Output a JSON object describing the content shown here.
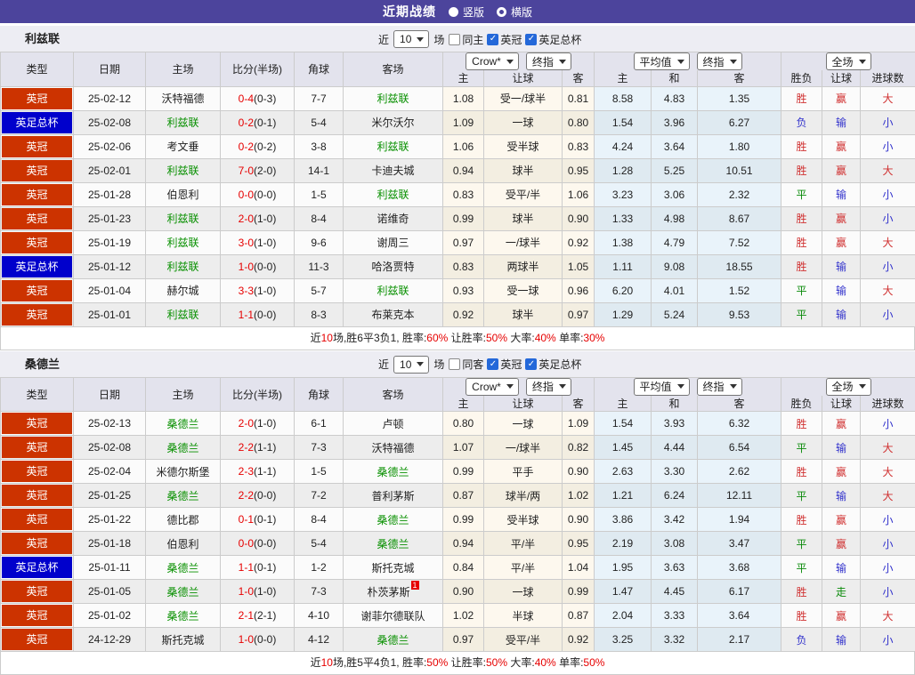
{
  "title_bar": {
    "title": "近期战绩",
    "radios": [
      {
        "label": "竖版",
        "selected": true
      },
      {
        "label": "横版",
        "selected": false
      }
    ]
  },
  "colors": {
    "accent_purple": "#4c449c",
    "league_championship_red": "#cc3300",
    "league_facup_blue": "#0000cc",
    "focus_team_green": "#089000",
    "score_red": "#e60000",
    "result_win_red": "#d03030",
    "result_lose_blue": "#3333cc",
    "result_draw_green": "#0a8a0a"
  },
  "result_color_map": {
    "胜": "red",
    "赢": "red",
    "大": "red",
    "平": "green",
    "走": "green",
    "负": "blue",
    "输": "blue",
    "小": "blue"
  },
  "sections": [
    {
      "team": "利兹联",
      "filter": {
        "prefix": "近",
        "count": "10",
        "suffix": "场",
        "checkboxes": [
          {
            "label": "同主",
            "checked": false
          },
          {
            "label": "英冠",
            "checked": true
          },
          {
            "label": "英足总杯",
            "checked": true
          }
        ]
      },
      "header": {
        "cols": [
          "类型",
          "日期",
          "主场",
          "比分(半场)",
          "角球",
          "客场"
        ],
        "group1_selects": [
          "Crow*",
          "终指"
        ],
        "group2_selects": [
          "平均值",
          "终指"
        ],
        "group3_selects": [
          "全场"
        ],
        "sub": [
          "主",
          "让球",
          "客",
          "主",
          "和",
          "客",
          "胜负",
          "让球",
          "进球数"
        ]
      },
      "rows": [
        {
          "league": "英冠",
          "date": "25-02-12",
          "home": "沃特福德",
          "home_focus": false,
          "score": "0-4",
          "half": "(0-3)",
          "corner": "7-7",
          "away": "利兹联",
          "away_focus": true,
          "odds": [
            "1.08",
            "受一/球半",
            "0.81"
          ],
          "avg": [
            "8.58",
            "4.83",
            "1.35"
          ],
          "results": [
            "胜",
            "赢",
            "大"
          ]
        },
        {
          "league": "英足总杯",
          "date": "25-02-08",
          "home": "利兹联",
          "home_focus": true,
          "score": "0-2",
          "half": "(0-1)",
          "corner": "5-4",
          "away": "米尔沃尔",
          "away_focus": false,
          "odds": [
            "1.09",
            "一球",
            "0.80"
          ],
          "avg": [
            "1.54",
            "3.96",
            "6.27"
          ],
          "results": [
            "负",
            "输",
            "小"
          ]
        },
        {
          "league": "英冠",
          "date": "25-02-06",
          "home": "考文垂",
          "home_focus": false,
          "score": "0-2",
          "half": "(0-2)",
          "corner": "3-8",
          "away": "利兹联",
          "away_focus": true,
          "odds": [
            "1.06",
            "受半球",
            "0.83"
          ],
          "avg": [
            "4.24",
            "3.64",
            "1.80"
          ],
          "results": [
            "胜",
            "赢",
            "小"
          ]
        },
        {
          "league": "英冠",
          "date": "25-02-01",
          "home": "利兹联",
          "home_focus": true,
          "score": "7-0",
          "half": "(2-0)",
          "corner": "14-1",
          "away": "卡迪夫城",
          "away_focus": false,
          "odds": [
            "0.94",
            "球半",
            "0.95"
          ],
          "avg": [
            "1.28",
            "5.25",
            "10.51"
          ],
          "results": [
            "胜",
            "赢",
            "大"
          ]
        },
        {
          "league": "英冠",
          "date": "25-01-28",
          "home": "伯恩利",
          "home_focus": false,
          "score": "0-0",
          "half": "(0-0)",
          "corner": "1-5",
          "away": "利兹联",
          "away_focus": true,
          "odds": [
            "0.83",
            "受平/半",
            "1.06"
          ],
          "avg": [
            "3.23",
            "3.06",
            "2.32"
          ],
          "results": [
            "平",
            "输",
            "小"
          ]
        },
        {
          "league": "英冠",
          "date": "25-01-23",
          "home": "利兹联",
          "home_focus": true,
          "score": "2-0",
          "half": "(1-0)",
          "corner": "8-4",
          "away": "诺维奇",
          "away_focus": false,
          "odds": [
            "0.99",
            "球半",
            "0.90"
          ],
          "avg": [
            "1.33",
            "4.98",
            "8.67"
          ],
          "results": [
            "胜",
            "赢",
            "小"
          ]
        },
        {
          "league": "英冠",
          "date": "25-01-19",
          "home": "利兹联",
          "home_focus": true,
          "score": "3-0",
          "half": "(1-0)",
          "corner": "9-6",
          "away": "谢周三",
          "away_focus": false,
          "odds": [
            "0.97",
            "一/球半",
            "0.92"
          ],
          "avg": [
            "1.38",
            "4.79",
            "7.52"
          ],
          "results": [
            "胜",
            "赢",
            "大"
          ]
        },
        {
          "league": "英足总杯",
          "date": "25-01-12",
          "home": "利兹联",
          "home_focus": true,
          "score": "1-0",
          "half": "(0-0)",
          "corner": "11-3",
          "away": "哈洛贾特",
          "away_focus": false,
          "odds": [
            "0.83",
            "两球半",
            "1.05"
          ],
          "avg": [
            "1.11",
            "9.08",
            "18.55"
          ],
          "results": [
            "胜",
            "输",
            "小"
          ]
        },
        {
          "league": "英冠",
          "date": "25-01-04",
          "home": "赫尔城",
          "home_focus": false,
          "score": "3-3",
          "half": "(1-0)",
          "corner": "5-7",
          "away": "利兹联",
          "away_focus": true,
          "odds": [
            "0.93",
            "受一球",
            "0.96"
          ],
          "avg": [
            "6.20",
            "4.01",
            "1.52"
          ],
          "results": [
            "平",
            "输",
            "大"
          ]
        },
        {
          "league": "英冠",
          "date": "25-01-01",
          "home": "利兹联",
          "home_focus": true,
          "score": "1-1",
          "half": "(0-0)",
          "corner": "8-3",
          "away": "布莱克本",
          "away_focus": false,
          "odds": [
            "0.92",
            "球半",
            "0.97"
          ],
          "avg": [
            "1.29",
            "5.24",
            "9.53"
          ],
          "results": [
            "平",
            "输",
            "小"
          ]
        }
      ],
      "summary": [
        {
          "t": "近"
        },
        {
          "t": "10",
          "r": true
        },
        {
          "t": "场,胜6平3负1, 胜率:"
        },
        {
          "t": "60%",
          "r": true
        },
        {
          "t": " 让胜率:"
        },
        {
          "t": "50%",
          "r": true
        },
        {
          "t": " 大率:"
        },
        {
          "t": "40%",
          "r": true
        },
        {
          "t": " 单率:"
        },
        {
          "t": "30%",
          "r": true
        }
      ]
    },
    {
      "team": "桑德兰",
      "filter": {
        "prefix": "近",
        "count": "10",
        "suffix": "场",
        "checkboxes": [
          {
            "label": "同客",
            "checked": false
          },
          {
            "label": "英冠",
            "checked": true
          },
          {
            "label": "英足总杯",
            "checked": true
          }
        ]
      },
      "header": {
        "cols": [
          "类型",
          "日期",
          "主场",
          "比分(半场)",
          "角球",
          "客场"
        ],
        "group1_selects": [
          "Crow*",
          "终指"
        ],
        "group2_selects": [
          "平均值",
          "终指"
        ],
        "group3_selects": [
          "全场"
        ],
        "sub": [
          "主",
          "让球",
          "客",
          "主",
          "和",
          "客",
          "胜负",
          "让球",
          "进球数"
        ]
      },
      "rows": [
        {
          "league": "英冠",
          "date": "25-02-13",
          "home": "桑德兰",
          "home_focus": true,
          "score": "2-0",
          "half": "(1-0)",
          "corner": "6-1",
          "away": "卢顿",
          "away_focus": false,
          "odds": [
            "0.80",
            "一球",
            "1.09"
          ],
          "avg": [
            "1.54",
            "3.93",
            "6.32"
          ],
          "results": [
            "胜",
            "赢",
            "小"
          ]
        },
        {
          "league": "英冠",
          "date": "25-02-08",
          "home": "桑德兰",
          "home_focus": true,
          "score": "2-2",
          "half": "(1-1)",
          "corner": "7-3",
          "away": "沃特福德",
          "away_focus": false,
          "odds": [
            "1.07",
            "一/球半",
            "0.82"
          ],
          "avg": [
            "1.45",
            "4.44",
            "6.54"
          ],
          "results": [
            "平",
            "输",
            "大"
          ]
        },
        {
          "league": "英冠",
          "date": "25-02-04",
          "home": "米德尔斯堡",
          "home_focus": false,
          "score": "2-3",
          "half": "(1-1)",
          "corner": "1-5",
          "away": "桑德兰",
          "away_focus": true,
          "odds": [
            "0.99",
            "平手",
            "0.90"
          ],
          "avg": [
            "2.63",
            "3.30",
            "2.62"
          ],
          "results": [
            "胜",
            "赢",
            "大"
          ]
        },
        {
          "league": "英冠",
          "date": "25-01-25",
          "home": "桑德兰",
          "home_focus": true,
          "score": "2-2",
          "half": "(0-0)",
          "corner": "7-2",
          "away": "普利茅斯",
          "away_focus": false,
          "odds": [
            "0.87",
            "球半/两",
            "1.02"
          ],
          "avg": [
            "1.21",
            "6.24",
            "12.11"
          ],
          "results": [
            "平",
            "输",
            "大"
          ]
        },
        {
          "league": "英冠",
          "date": "25-01-22",
          "home": "德比郡",
          "home_focus": false,
          "score": "0-1",
          "half": "(0-1)",
          "corner": "8-4",
          "away": "桑德兰",
          "away_focus": true,
          "odds": [
            "0.99",
            "受半球",
            "0.90"
          ],
          "avg": [
            "3.86",
            "3.42",
            "1.94"
          ],
          "results": [
            "胜",
            "赢",
            "小"
          ]
        },
        {
          "league": "英冠",
          "date": "25-01-18",
          "home": "伯恩利",
          "home_focus": false,
          "score": "0-0",
          "half": "(0-0)",
          "corner": "5-4",
          "away": "桑德兰",
          "away_focus": true,
          "odds": [
            "0.94",
            "平/半",
            "0.95"
          ],
          "avg": [
            "2.19",
            "3.08",
            "3.47"
          ],
          "results": [
            "平",
            "赢",
            "小"
          ]
        },
        {
          "league": "英足总杯",
          "date": "25-01-11",
          "home": "桑德兰",
          "home_focus": true,
          "score": "1-1",
          "half": "(0-1)",
          "corner": "1-2",
          "away": "斯托克城",
          "away_focus": false,
          "odds": [
            "0.84",
            "平/半",
            "1.04"
          ],
          "avg": [
            "1.95",
            "3.63",
            "3.68"
          ],
          "results": [
            "平",
            "输",
            "小"
          ]
        },
        {
          "league": "英冠",
          "date": "25-01-05",
          "home": "桑德兰",
          "home_focus": true,
          "score": "1-0",
          "half": "(1-0)",
          "corner": "7-3",
          "away": "朴茨茅斯",
          "away_focus": false,
          "away_card": "1",
          "odds": [
            "0.90",
            "一球",
            "0.99"
          ],
          "avg": [
            "1.47",
            "4.45",
            "6.17"
          ],
          "results": [
            "胜",
            "走",
            "小"
          ]
        },
        {
          "league": "英冠",
          "date": "25-01-02",
          "home": "桑德兰",
          "home_focus": true,
          "score": "2-1",
          "half": "(2-1)",
          "corner": "4-10",
          "away": "谢菲尔德联队",
          "away_focus": false,
          "odds": [
            "1.02",
            "半球",
            "0.87"
          ],
          "avg": [
            "2.04",
            "3.33",
            "3.64"
          ],
          "results": [
            "胜",
            "赢",
            "大"
          ]
        },
        {
          "league": "英冠",
          "date": "24-12-29",
          "home": "斯托克城",
          "home_focus": false,
          "score": "1-0",
          "half": "(0-0)",
          "corner": "4-12",
          "away": "桑德兰",
          "away_focus": true,
          "odds": [
            "0.97",
            "受平/半",
            "0.92"
          ],
          "avg": [
            "3.25",
            "3.32",
            "2.17"
          ],
          "results": [
            "负",
            "输",
            "小"
          ]
        }
      ],
      "summary": [
        {
          "t": "近"
        },
        {
          "t": "10",
          "r": true
        },
        {
          "t": "场,胜5平4负1, 胜率:"
        },
        {
          "t": "50%",
          "r": true
        },
        {
          "t": " 让胜率:"
        },
        {
          "t": "50%",
          "r": true
        },
        {
          "t": " 大率:"
        },
        {
          "t": "40%",
          "r": true
        },
        {
          "t": " 单率:"
        },
        {
          "t": "50%",
          "r": true
        }
      ]
    }
  ]
}
